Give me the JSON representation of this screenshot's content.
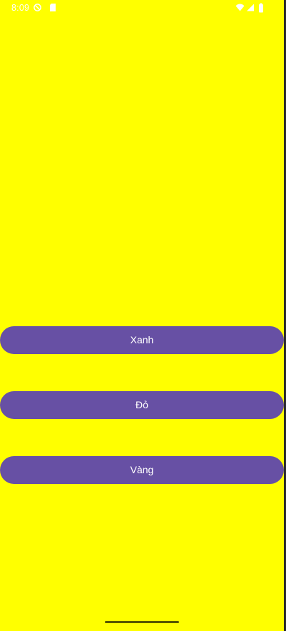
{
  "status_bar": {
    "time": "8:09",
    "icons": {
      "left": [
        "do-not-disturb-icon",
        "sim-card-icon"
      ],
      "right": [
        "wifi-icon",
        "cell-signal-icon",
        "battery-icon"
      ]
    },
    "color": "#ffffff"
  },
  "screen": {
    "background_color": "#ffff00"
  },
  "buttons": [
    {
      "label": "Xanh",
      "color": "#6750a4"
    },
    {
      "label": "Đỏ",
      "color": "#6750a4"
    },
    {
      "label": "Vàng",
      "color": "#6750a4"
    }
  ]
}
